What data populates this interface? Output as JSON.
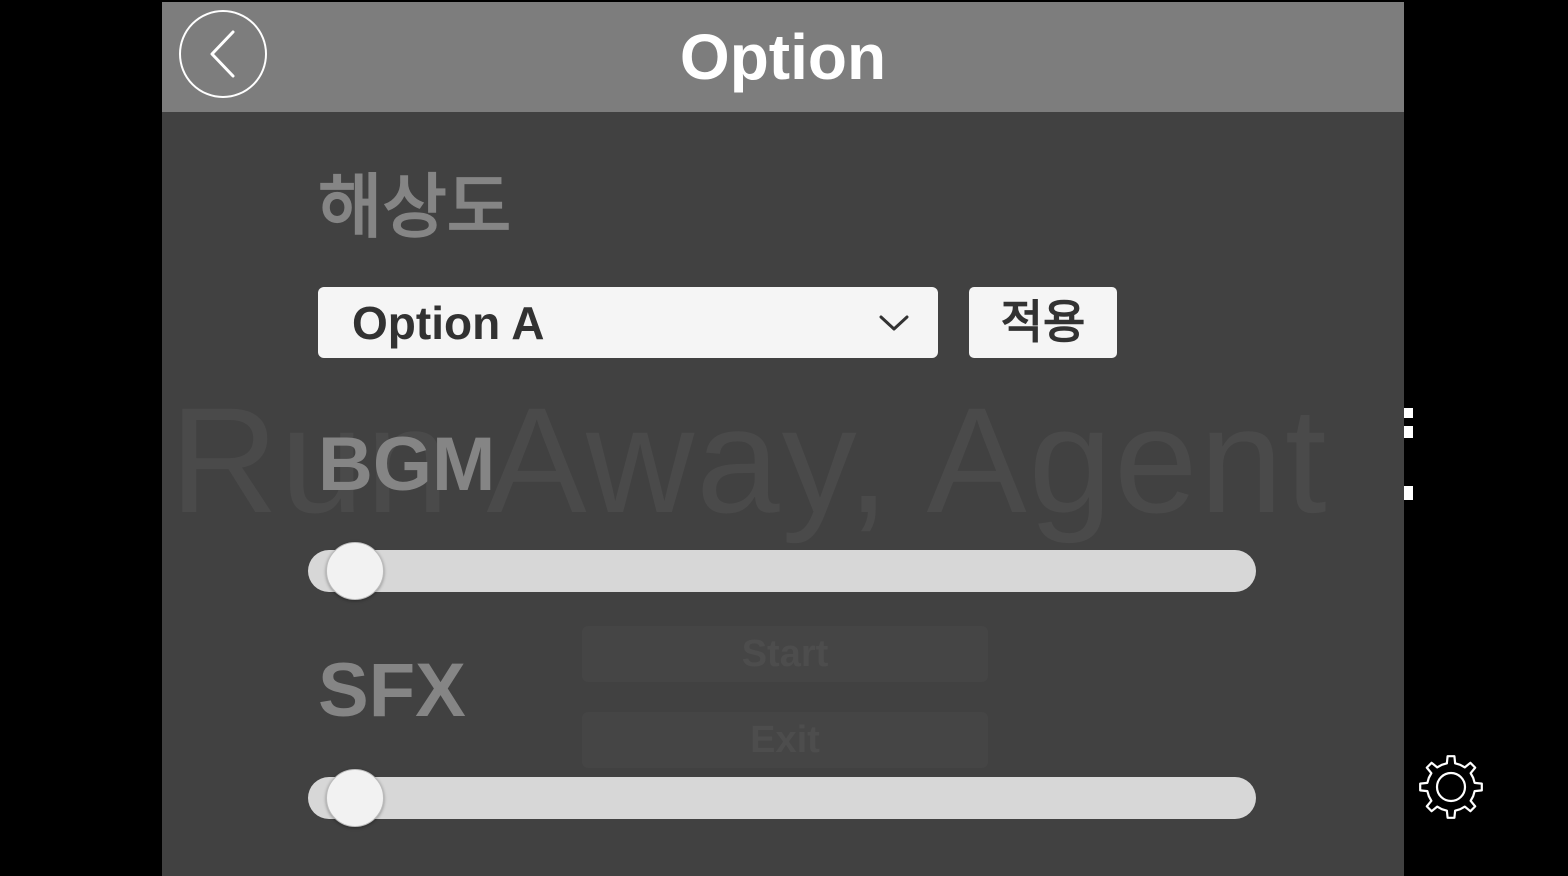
{
  "header": {
    "title": "Option",
    "back_icon": "chevron-left-icon"
  },
  "background": {
    "title_text": "Run Away, Agent",
    "start_label": "Start",
    "exit_label": "Exit"
  },
  "resolution": {
    "label": "해상도",
    "selected_option": "Option A",
    "dropdown_icon": "chevron-down-icon",
    "apply_label": "적용"
  },
  "bgm": {
    "label": "BGM",
    "volume_fraction": 0.0
  },
  "sfx": {
    "label": "SFX",
    "volume_fraction": 0.0
  },
  "settings_icon": "gear-icon",
  "colors": {
    "page_background": "#000000",
    "panel_background": "#414141",
    "header_background": "#7d7d7d",
    "label_text": "#858585",
    "control_background": "#f5f5f5",
    "slider_track": "#d7d7d7",
    "control_text": "#323232"
  }
}
